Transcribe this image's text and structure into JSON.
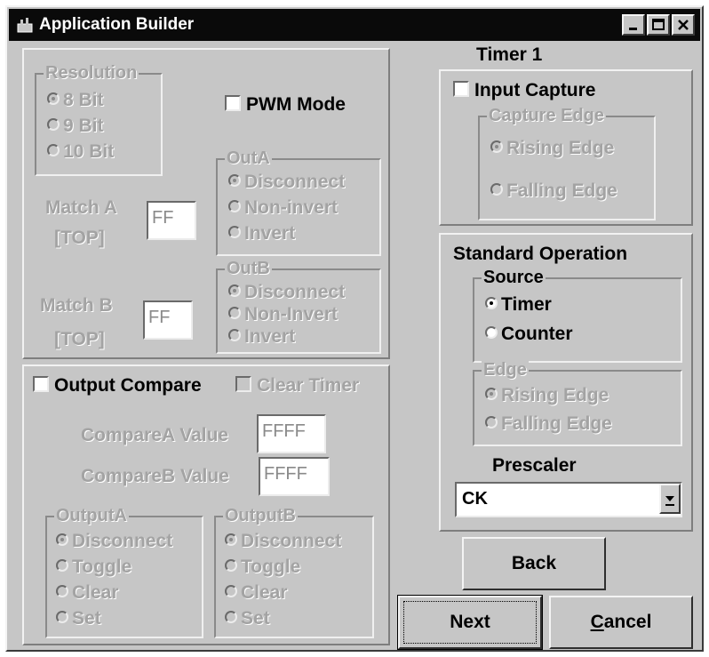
{
  "window": {
    "title": "Application Builder",
    "minimize_icon": "minimize-icon",
    "maximize_icon": "maximize-icon",
    "close_icon": "close-icon"
  },
  "pwm_panel": {
    "resolution_group": "Resolution",
    "resolution_options": [
      "8 Bit",
      "9 Bit",
      "10 Bit"
    ],
    "resolution_selected": "8 Bit",
    "pwm_mode_label": "PWM Mode",
    "pwm_mode_checked": false,
    "match_a_label": "Match A",
    "match_a_sub": "[TOP]",
    "match_a_value": "FF",
    "match_b_label": "Match B",
    "match_b_sub": "[TOP]",
    "match_b_value": "FF",
    "out_a_group": "OutA",
    "out_a_options": [
      "Disconnect",
      "Non-invert",
      "Invert"
    ],
    "out_a_selected": "Disconnect",
    "out_b_group": "OutB",
    "out_b_options": [
      "Disconnect",
      "Non-Invert",
      "Invert"
    ],
    "out_b_selected": "Disconnect"
  },
  "output_compare_panel": {
    "output_compare_label": "Output Compare",
    "output_compare_checked": false,
    "clear_timer_label": "Clear Timer",
    "clear_timer_checked": false,
    "compare_a_label": "CompareA Value",
    "compare_a_value": "FFFF",
    "compare_b_label": "CompareB Value",
    "compare_b_value": "FFFF",
    "output_a_group": "OutputA",
    "output_a_options": [
      "Disconnect",
      "Toggle",
      "Clear",
      "Set"
    ],
    "output_a_selected": "Disconnect",
    "output_b_group": "OutputB",
    "output_b_options": [
      "Disconnect",
      "Toggle",
      "Clear",
      "Set"
    ],
    "output_b_selected": "Disconnect"
  },
  "timer_section": {
    "heading": "Timer 1",
    "input_capture_label": "Input Capture",
    "input_capture_checked": false,
    "capture_edge_group": "Capture Edge",
    "capture_edge_options": [
      "Rising Edge",
      "Falling Edge"
    ],
    "capture_edge_selected": "Rising Edge"
  },
  "standard_operation": {
    "heading": "Standard Operation",
    "source_group": "Source",
    "source_options": [
      "Timer",
      "Counter"
    ],
    "source_selected": "Timer",
    "edge_group": "Edge",
    "edge_options": [
      "Rising Edge",
      "Falling Edge"
    ],
    "edge_selected": "Rising Edge",
    "prescaler_label": "Prescaler",
    "prescaler_value": "CK"
  },
  "buttons": {
    "back": "Back",
    "next": "Next",
    "cancel_prefix": "C",
    "cancel_rest": "ancel"
  }
}
